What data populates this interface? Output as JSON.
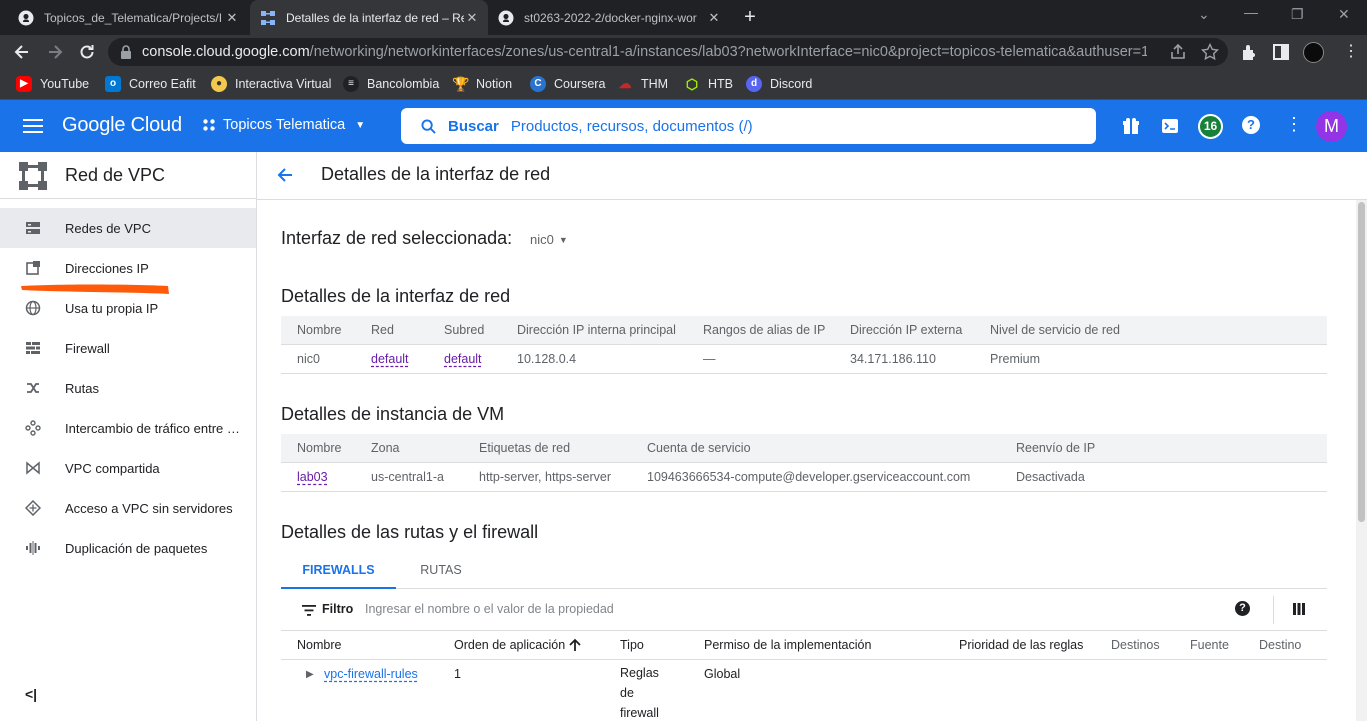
{
  "browser": {
    "tabs": [
      {
        "title": "Topicos_de_Telematica/Projects/I",
        "active": false,
        "icon": "github-icon"
      },
      {
        "title": "Detalles de la interfaz de red – Red",
        "active": true,
        "icon": "vpc-icon"
      },
      {
        "title": "st0263-2022-2/docker-nginx-wor",
        "active": false,
        "icon": "github-icon"
      }
    ],
    "url_host": "console.cloud.google.com",
    "url_path": "/networking/networkinterfaces/zones/us-central1-a/instances/lab03?networkInterface=nic0&project=topicos-telematica&authuser=1&…",
    "bookmarks": [
      {
        "label": "YouTube",
        "icon": "youtube-icon",
        "color": "#ff0000"
      },
      {
        "label": "Correo Eafit",
        "icon": "outlook-icon",
        "color": "#0078d4"
      },
      {
        "label": "Interactiva Virtual",
        "icon": "interactiva-icon",
        "color": "#f2c94c"
      },
      {
        "label": "Bancolombia",
        "icon": "bancolombia-icon",
        "color": "#e8eaed"
      },
      {
        "label": "Notion",
        "icon": "trophy-icon",
        "color": "#f4b400"
      },
      {
        "label": "Coursera",
        "icon": "coursera-icon",
        "color": "#2a73cc"
      },
      {
        "label": "THM",
        "icon": "thm-icon",
        "color": "#c62828"
      },
      {
        "label": "HTB",
        "icon": "htb-icon",
        "color": "#9fef00"
      },
      {
        "label": "Discord",
        "icon": "discord-icon",
        "color": "#5865f2"
      }
    ]
  },
  "gcp": {
    "brand": "Google Cloud",
    "project": "Topicos Telematica",
    "search_label": "Buscar",
    "search_placeholder": "Productos, recursos, documentos (/)",
    "notifications": "16",
    "avatar": "M"
  },
  "sidebar": {
    "title": "Red de VPC",
    "items": [
      {
        "label": "Redes de VPC",
        "icon": "vpc-networks-icon",
        "selected": true
      },
      {
        "label": "Direcciones IP",
        "icon": "ip-address-icon",
        "selected": false
      },
      {
        "label": "Usa tu propia IP",
        "icon": "globe-icon",
        "selected": false
      },
      {
        "label": "Firewall",
        "icon": "firewall-icon",
        "selected": false
      },
      {
        "label": "Rutas",
        "icon": "routes-icon",
        "selected": false
      },
      {
        "label": "Intercambio de tráfico entre …",
        "icon": "peering-icon",
        "selected": false
      },
      {
        "label": "VPC compartida",
        "icon": "shared-vpc-icon",
        "selected": false
      },
      {
        "label": "Acceso a VPC sin servidores",
        "icon": "serverless-icon",
        "selected": false
      },
      {
        "label": "Duplicación de paquetes",
        "icon": "packet-mirroring-icon",
        "selected": false
      }
    ],
    "highlight_color": "#ff5a0a"
  },
  "main": {
    "title": "Detalles de la interfaz de red",
    "selected_label": "Interfaz de red seleccionada:",
    "selected_value": "nic0",
    "nic": {
      "heading": "Detalles de la interfaz de red",
      "columns": [
        "Nombre",
        "Red",
        "Subred",
        "Dirección IP interna principal",
        "Rangos de alias de IP",
        "Dirección IP externa",
        "Nivel de servicio de red"
      ],
      "row": [
        "nic0",
        "default",
        "default",
        "10.128.0.4",
        "—",
        "34.171.186.110",
        "Premium"
      ]
    },
    "vm": {
      "heading": "Detalles de instancia de VM",
      "columns": [
        "Nombre",
        "Zona",
        "Etiquetas de red",
        "Cuenta de servicio",
        "Reenvío de IP"
      ],
      "row": [
        "lab03",
        "us-central1-a",
        "http-server, https-server",
        "109463666534-compute@developer.gserviceaccount.com",
        "Desactivada"
      ]
    },
    "routes": {
      "heading": "Detalles de las rutas y el firewall",
      "tabs": [
        "FIREWALLS",
        "RUTAS"
      ],
      "filter_label": "Filtro",
      "filter_placeholder": "Ingresar el nombre o el valor de la propiedad",
      "columns": [
        "Nombre",
        "Orden de aplicación",
        "Tipo",
        "Permiso de la implementación",
        "Prioridad de las reglas",
        "Destinos",
        "Fuente",
        "Destino"
      ],
      "row": {
        "name": "vpc-firewall-rules",
        "order": "1",
        "type_lines": [
          "Reglas",
          "de",
          "firewall"
        ],
        "scope": "Global"
      }
    }
  }
}
